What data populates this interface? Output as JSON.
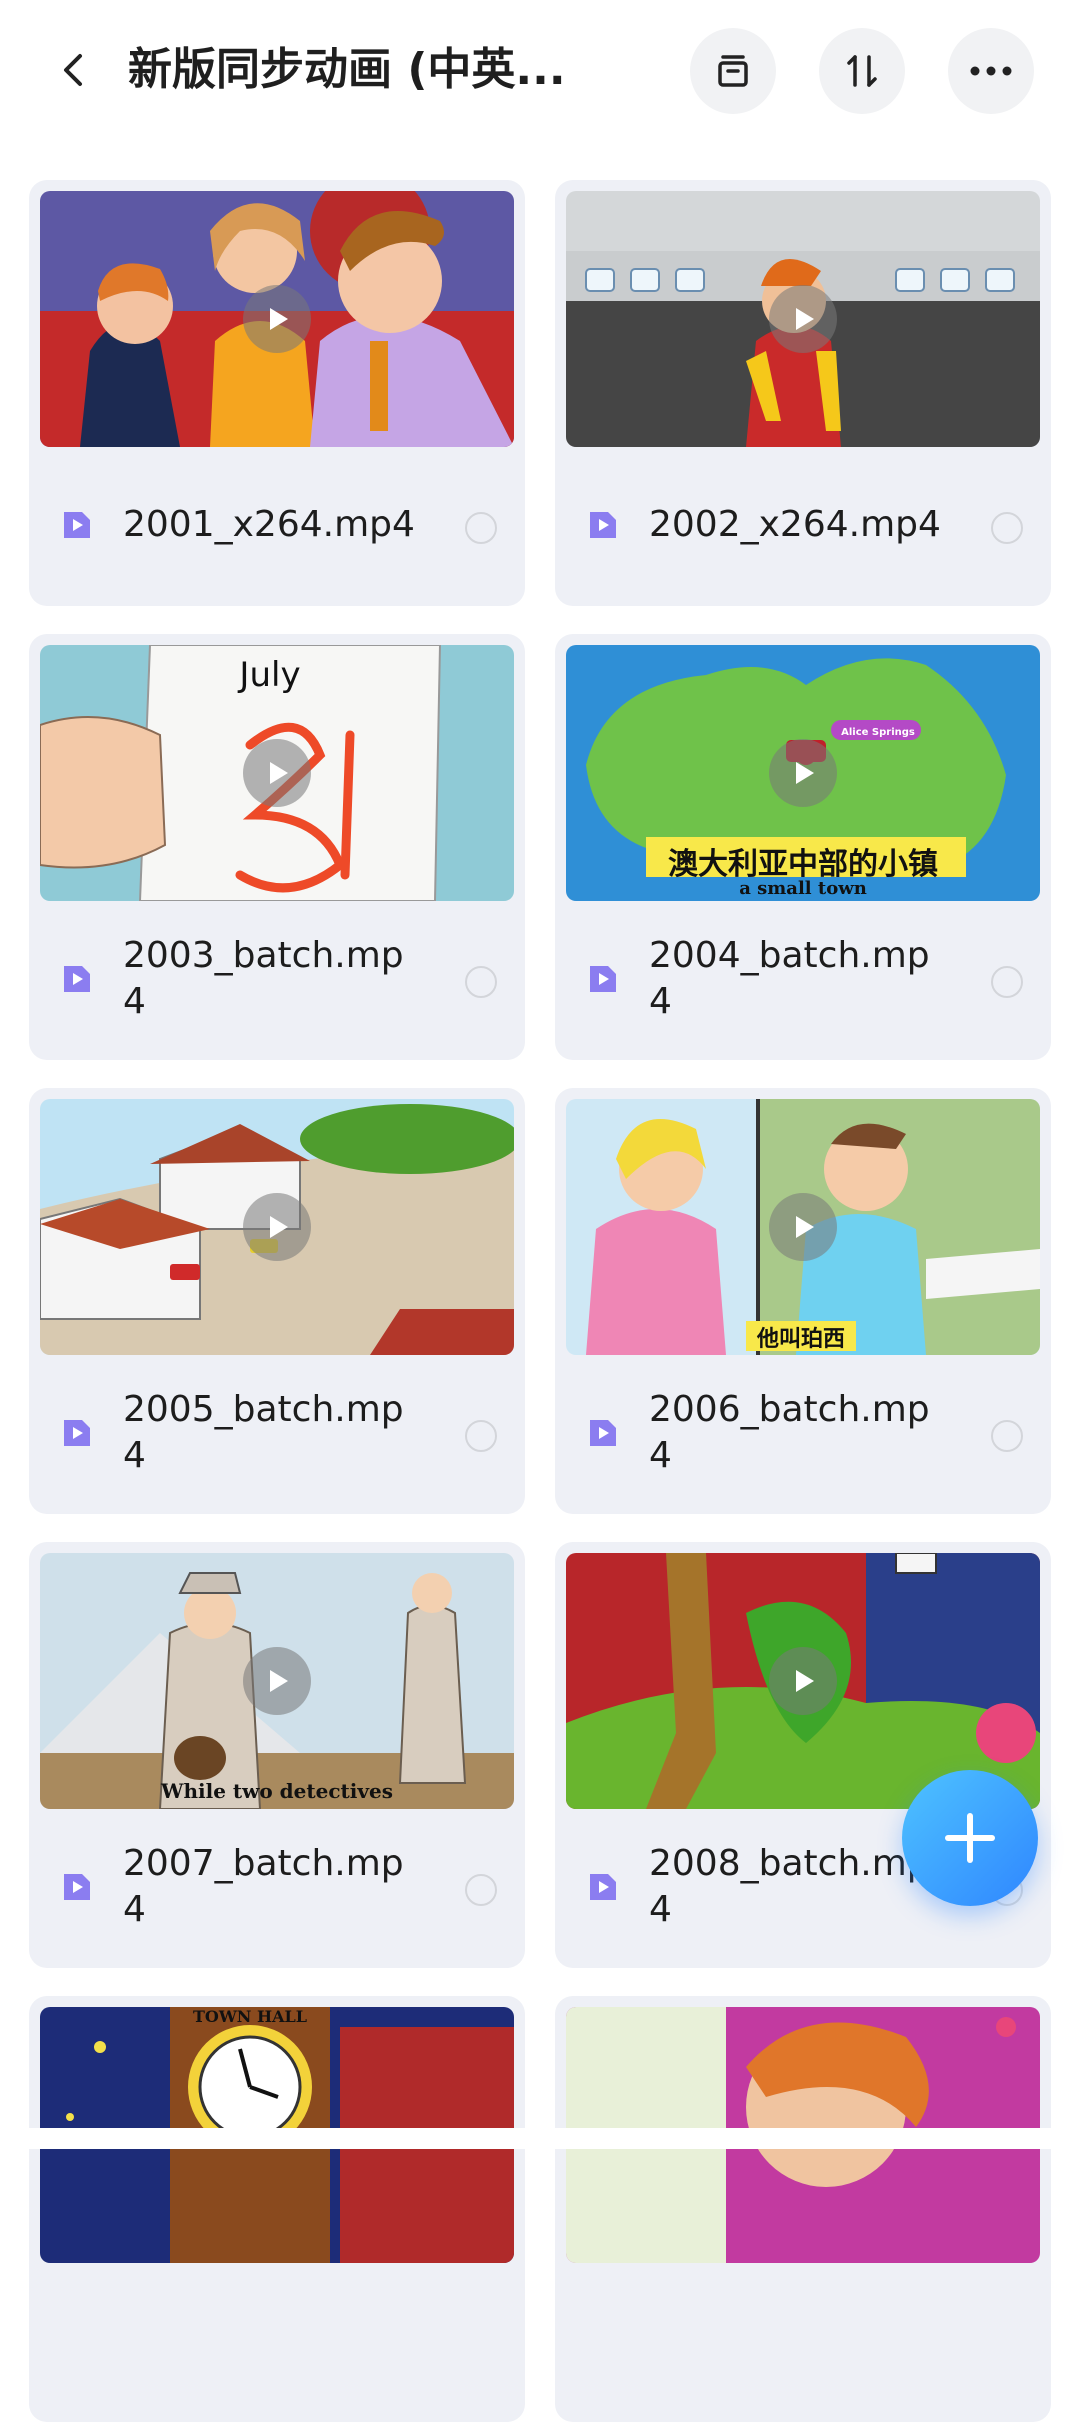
{
  "header": {
    "title": "新版同步动画 (中英...",
    "back_icon": "chevron-left-icon",
    "actions": [
      {
        "name": "archive-button",
        "icon": "archive-icon"
      },
      {
        "name": "sort-button",
        "icon": "sort-icon"
      },
      {
        "name": "more-button",
        "icon": "more-horizontal-icon"
      }
    ]
  },
  "files": [
    {
      "name": "2001_x264.mp4"
    },
    {
      "name": "2002_x264.mp4"
    },
    {
      "name": "2003_batch.mp4",
      "caption": "July"
    },
    {
      "name": "2004_batch.mp4",
      "caption": "澳大利亚中部的小镇",
      "caption2": "a small town",
      "map_label": "Alice Springs"
    },
    {
      "name": "2005_batch.mp4"
    },
    {
      "name": "2006_batch.mp4",
      "caption": "他叫珀西"
    },
    {
      "name": "2007_batch.mp4",
      "caption": "While two detectives"
    },
    {
      "name": "2008_batch.mp4"
    },
    {
      "name": "",
      "caption": "TOWN HALL"
    },
    {
      "name": ""
    }
  ],
  "fab": {
    "icon": "plus-icon"
  },
  "colors": {
    "accent": "#2f86ff",
    "file_icon": "#8b7df0",
    "card_bg": "#eef0f6"
  }
}
